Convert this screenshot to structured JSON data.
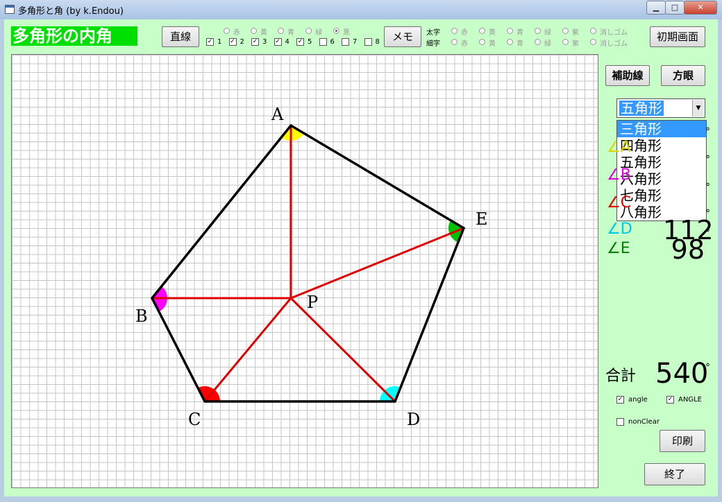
{
  "window": {
    "title": "多角形と角 (by k.Endou)",
    "minimize": "▁",
    "maximize": "□",
    "close": "✕"
  },
  "header": {
    "app_title": "多角形の内角",
    "line_button": "直線",
    "memo_button": "メモ",
    "reset_button": "初期画面",
    "color_options": [
      "赤",
      "黄",
      "青",
      "緑",
      "黒"
    ],
    "selected_color": "黒",
    "vertex_checks": [
      {
        "label": "1",
        "checked": true
      },
      {
        "label": "2",
        "checked": true
      },
      {
        "label": "3",
        "checked": true
      },
      {
        "label": "4",
        "checked": true
      },
      {
        "label": "5",
        "checked": true
      },
      {
        "label": "6",
        "checked": false
      },
      {
        "label": "7",
        "checked": false
      },
      {
        "label": "8",
        "checked": false
      }
    ],
    "thick_label": "太字",
    "thin_label": "細字",
    "memo_colors": [
      "赤",
      "黄",
      "青",
      "緑",
      "紫",
      "消しゴム"
    ]
  },
  "right_panel": {
    "aux_button": "補助線",
    "grid_button": "方眼",
    "shape_select": "五角形",
    "shape_options": [
      "三角形",
      "四角形",
      "五角形",
      "六角形",
      "七角形",
      "八角形"
    ],
    "highlighted_option": "三角形",
    "angles": [
      {
        "label": "∠A",
        "value": "",
        "color": "#d8d800"
      },
      {
        "label": "∠B",
        "value": "",
        "color": "#e000e0"
      },
      {
        "label": "∠C",
        "value": "",
        "color": "#e00000"
      },
      {
        "label": "∠D",
        "value": "112",
        "color": "#00c8e8"
      },
      {
        "label": "∠E",
        "value": "98",
        "color": "#008000"
      }
    ],
    "degree_symbol": "°",
    "total_label": "合計",
    "total_value": "540",
    "total_degree": "°",
    "check_angle": {
      "label": "angle",
      "checked": true
    },
    "check_ANGLE": {
      "label": "ANGLE",
      "checked": true
    },
    "check_nonclear": {
      "label": "nonClear",
      "checked": false
    },
    "print_button": "印刷",
    "exit_button": "終了"
  },
  "figure": {
    "vertices": [
      {
        "name": "A",
        "color": "#ffff00"
      },
      {
        "name": "B",
        "color": "#ff00ff"
      },
      {
        "name": "C",
        "color": "#ff0000"
      },
      {
        "name": "D",
        "color": "#00ffff"
      },
      {
        "name": "E",
        "color": "#00c000"
      }
    ],
    "center_label": "P",
    "edge_color": "#000000",
    "aux_line_color": "#e00000"
  }
}
